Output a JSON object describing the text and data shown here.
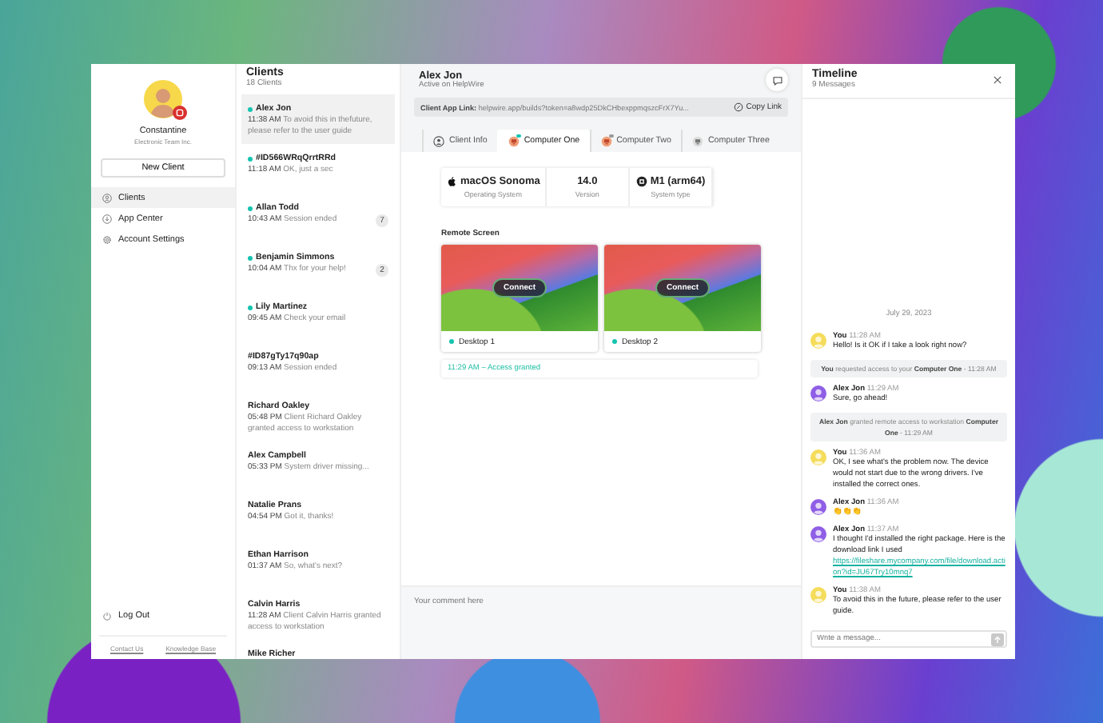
{
  "profile": {
    "name": "Constantine",
    "company": "Electronic Team Inc."
  },
  "new_client_button": "New Client",
  "nav": [
    {
      "label": "Clients",
      "selected": true,
      "kind": "clients"
    },
    {
      "label": "App Center",
      "selected": false,
      "kind": "apps"
    },
    {
      "label": "Account Settings",
      "selected": false,
      "kind": "settings"
    }
  ],
  "logout": "Log Out",
  "footer_links": [
    "Contact Us",
    "Knowledge Base"
  ],
  "clients": {
    "title": "Clients",
    "count": "18 Clients",
    "items": [
      {
        "name": "Alex Jon",
        "online": true,
        "time": "11:38 AM",
        "message": "To avoid this in thefuture, please refer to the user guide",
        "selected": true
      },
      {
        "name": "#ID566WRqQrrtRRd",
        "online": true,
        "time": "11:18 AM",
        "message": "OK, just a sec",
        "selected": false
      },
      {
        "name": "Allan Todd",
        "online": true,
        "time": "10:43 AM",
        "message": "Session ended",
        "badge": "7",
        "selected": false
      },
      {
        "name": "Benjamin Simmons",
        "online": true,
        "time": "10:04 AM",
        "message": "Thx for your help!",
        "badge": "2",
        "selected": false
      },
      {
        "name": "Lily Martinez",
        "online": true,
        "time": "09:45 AM",
        "message": "Check your email",
        "selected": false
      },
      {
        "name": "#ID87gTy17q90ap",
        "online": false,
        "time": "09:13 AM",
        "message": "Session ended",
        "selected": false
      },
      {
        "name": "Richard Oakley",
        "online": false,
        "time": "05:48 PM",
        "message": "Client Richard Oakley granted access to workstation",
        "selected": false
      },
      {
        "name": "Alex Campbell",
        "online": false,
        "time": "05:33 PM",
        "message": "System driver missing...",
        "selected": false
      },
      {
        "name": "Natalie Prans",
        "online": false,
        "time": "04:54 PM",
        "message": "Got it, thanks!",
        "selected": false
      },
      {
        "name": "Ethan Harrison",
        "online": false,
        "time": "01:37 AM",
        "message": "So, what's next?",
        "selected": false
      },
      {
        "name": "Calvin Harris",
        "online": false,
        "time": "11:28 AM",
        "message": "Client Calvin Harris granted access to workstation",
        "selected": false
      },
      {
        "name": "Mike Richer",
        "online": false,
        "selected": false
      }
    ]
  },
  "session": {
    "name": "Alex Jon",
    "status": "Active on HelpWire",
    "link_label": "Client App Link:",
    "link_url": "helpwire.app/builds?token=a8wdp25DkCHbexppmqszcFrX7Yu...",
    "copy_button": "Copy Link",
    "tabs": [
      {
        "label": "Client Info",
        "selected": false,
        "kind": "person",
        "active_dot": false
      },
      {
        "label": "Computer One",
        "selected": true,
        "kind": "computer",
        "active_dot": true
      },
      {
        "label": "Computer Two",
        "selected": false,
        "kind": "computer",
        "active_dot": true
      },
      {
        "label": "Computer Three",
        "selected": false,
        "kind": "computer-gray",
        "active_dot": false
      }
    ],
    "specs": [
      {
        "value": "macOS Sonoma",
        "label": "Operating System",
        "kind": "os"
      },
      {
        "value": "14.0",
        "label": "Version",
        "kind": "plain"
      },
      {
        "value": "M1 (arm64)",
        "label": "System type",
        "kind": "chip"
      }
    ],
    "remote_title": "Remote Screen",
    "desktops": [
      {
        "name": "Desktop 1",
        "online": true,
        "button": "Connect"
      },
      {
        "name": "Desktop 2",
        "online": true,
        "button": "Connect"
      }
    ],
    "event": "11:29 AM – Access granted",
    "comment_placeholder": "Your comment here"
  },
  "timeline": {
    "title": "Timeline",
    "count": "9 Messages",
    "date": "July 29, 2023",
    "messages": [
      {
        "kind": "message",
        "sender": "You",
        "time": "11:28 AM",
        "text": "Hello! Is it OK if I take a look right now?",
        "color": "#f5dc5a"
      },
      {
        "kind": "system",
        "text": "**You** requested access to your **Computer One** - 11:28 AM"
      },
      {
        "kind": "message",
        "sender": "Alex Jon",
        "time": "11:29 AM",
        "text": "Sure, go ahead!",
        "color": "#8f5ee6"
      },
      {
        "kind": "system",
        "text": "**Alex Jon** granted remote access to workstation **Computer One** - 11:29 AM"
      },
      {
        "kind": "message",
        "sender": "You",
        "time": "11:36 AM",
        "text": "OK, I see what's the problem now. The device would not start due to the wrong drivers. I've installed the correct ones.",
        "color": "#f5dc5a"
      },
      {
        "kind": "message",
        "sender": "Alex Jon",
        "time": "11:36 AM",
        "text": "👏👏👏",
        "color": "#8f5ee6"
      },
      {
        "kind": "message",
        "sender": "Alex Jon",
        "time": "11:37 AM",
        "text": "I thought I'd installed the right package. Here is the download link I used",
        "link": "https://fileshare.mycompany.com/file/download.action?id=JU67Try10mnq7",
        "color": "#8f5ee6"
      },
      {
        "kind": "message",
        "sender": "You",
        "time": "11:38 AM",
        "text": "To avoid this in the future, please refer to the user guide.",
        "color": "#f5dc5a"
      }
    ],
    "input_placeholder": "Write a message..."
  }
}
